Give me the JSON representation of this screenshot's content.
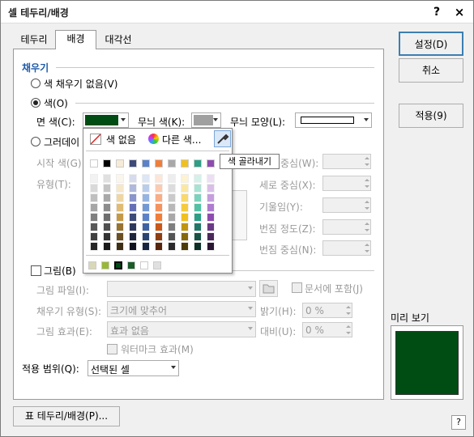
{
  "dialog": {
    "title": "셀 테두리/배경",
    "help": "?",
    "close": "×"
  },
  "tabs": [
    {
      "label": "테두리"
    },
    {
      "label": "배경"
    },
    {
      "label": "대각선"
    }
  ],
  "fill": {
    "section": "채우기",
    "no_fill": "색 채우기 없음(V)",
    "color": "색(O)",
    "face_color_label": "면 색(C):",
    "face_color": "#004d14",
    "pattern_color_label": "무늬 색(K):",
    "pattern_color": "#a0a0a0",
    "pattern_label": "무늬 모양(L):",
    "gradient": "그러데이",
    "start_color": "시작 색(G)",
    "type": "유형(T):",
    "h_center": "중심(W):",
    "v_center": "세로 중심(X):",
    "tilt": "기울임(Y):",
    "spread": "번짐 정도(Z):",
    "spread_center": "번짐 중심(N):"
  },
  "popup": {
    "no_color": "색 없음",
    "other_color": "다른 색...",
    "picker_tooltip": "색 골라내기",
    "top_row": [
      "#ffffff",
      "#000000",
      "#f7ebd7",
      "#3d4a7a",
      "#5b82c8",
      "#f07e3a",
      "#a8a8a8",
      "#f0c020",
      "#2c9f86",
      "#8d4db0"
    ],
    "columns": [
      [
        "#f2f2f2",
        "#d9d9d9",
        "#bfbfbf",
        "#a6a6a6",
        "#808080",
        "#595959",
        "#404040",
        "#262626"
      ],
      [
        "#e0e0e0",
        "#c4c4c4",
        "#a8a8a8",
        "#8c8c8c",
        "#6e6e6e",
        "#505050",
        "#333333",
        "#1a1a1a"
      ],
      [
        "#fbf6ec",
        "#f5e7c9",
        "#eed6a3",
        "#dfbb73",
        "#c49a48",
        "#977431",
        "#6a5022",
        "#3d2e13"
      ],
      [
        "#d7dbed",
        "#b0b8dc",
        "#8a95cb",
        "#6470b6",
        "#3d4a7a",
        "#2e385c",
        "#1f253d",
        "#10131f"
      ],
      [
        "#dce6f5",
        "#b9cdeb",
        "#96b4e1",
        "#7399d4",
        "#5b82c8",
        "#3e63a3",
        "#2a4472",
        "#172540"
      ],
      [
        "#fde5d8",
        "#fbcbb1",
        "#f8ae86",
        "#f4935f",
        "#f07e3a",
        "#c9581a",
        "#8f3e12",
        "#56250a"
      ],
      [
        "#ededed",
        "#dcdcdc",
        "#cacaca",
        "#b8b8b8",
        "#a8a8a8",
        "#7e7e7e",
        "#545454",
        "#2a2a2a"
      ],
      [
        "#fdf3d0",
        "#fbe7a2",
        "#f8d96e",
        "#f5cb3e",
        "#f0c020",
        "#bf9510",
        "#86690b",
        "#4c3b06"
      ],
      [
        "#d4f0e9",
        "#a9e2d3",
        "#7dd2bc",
        "#52c1a4",
        "#2c9f86",
        "#217868",
        "#175447",
        "#0c2f28"
      ],
      [
        "#ecdff4",
        "#d9bfe8",
        "#c49edd",
        "#ae7cd0",
        "#8d4db0",
        "#6b3a86",
        "#4a285c",
        "#291633"
      ]
    ],
    "recent": [
      "#d8d8b8",
      "#98b838",
      "#004d14",
      "#1a5c2a",
      "#ffffff",
      "#e0e0e0"
    ]
  },
  "picture": {
    "checkbox": "그림(B)",
    "file": "그림 파일(I):",
    "include": "문서에 포함(J)",
    "fill_type": "채우기 유형(S):",
    "fill_type_value": "크기에 맞추어",
    "effect": "그림 효과(E):",
    "effect_value": "효과 없음",
    "brightness": "밝기(H):",
    "brightness_value": "0 %",
    "contrast": "대비(U):",
    "contrast_value": "0 %",
    "watermark": "워터마크 효과(M)"
  },
  "scope": {
    "label": "적용 범위(Q):",
    "value": "선택된 셀"
  },
  "buttons": {
    "ok": "설정(D)",
    "cancel": "취소",
    "apply": "적용(9)",
    "table_border": "표 테두리/배경(P)..."
  },
  "preview": {
    "label": "미리 보기",
    "color": "#004d14"
  }
}
